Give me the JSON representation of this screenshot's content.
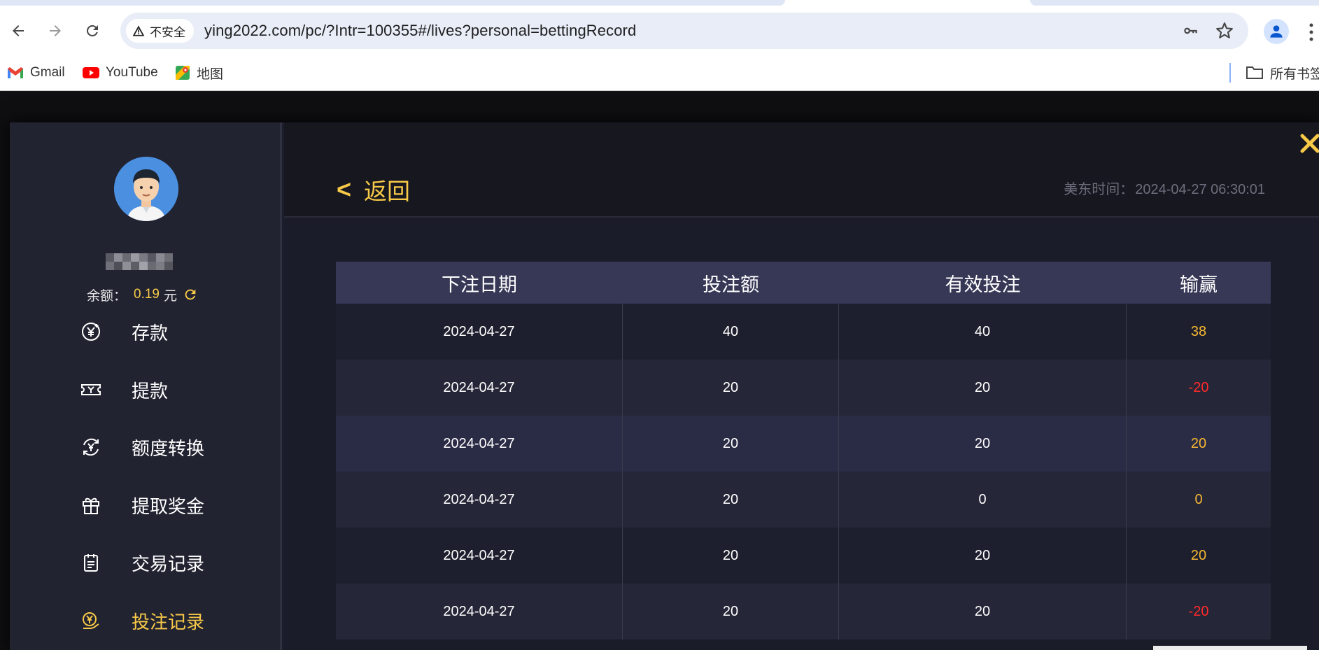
{
  "browser": {
    "security_label": "不安全",
    "url": "ying2022.com/pc/?Intr=100355#/lives?personal=bettingRecord",
    "bookmarks": [
      {
        "label": "Gmail",
        "icon": "gmail-icon"
      },
      {
        "label": "YouTube",
        "icon": "youtube-icon"
      },
      {
        "label": "地图",
        "icon": "maps-icon"
      }
    ],
    "all_bookmarks_label": "所有书签"
  },
  "sidebar": {
    "balance_label": "余额：",
    "balance_value": "0.19",
    "balance_unit": "元",
    "menu": [
      {
        "label": "存款",
        "icon": "deposit-icon",
        "active": false
      },
      {
        "label": "提款",
        "icon": "withdraw-icon",
        "active": false
      },
      {
        "label": "额度转换",
        "icon": "transfer-icon",
        "active": false
      },
      {
        "label": "提取奖金",
        "icon": "gift-icon",
        "active": false
      },
      {
        "label": "交易记录",
        "icon": "clipboard-icon",
        "active": false
      },
      {
        "label": "投注记录",
        "icon": "bet-record-icon",
        "active": true
      }
    ]
  },
  "content": {
    "back_label": "返回",
    "east_time_label": "美东时间：",
    "east_time_value": "2024-04-27 06:30:01"
  },
  "table": {
    "headers": [
      "下注日期",
      "投注额",
      "有效投注",
      "输赢"
    ],
    "rows": [
      {
        "date": "2024-04-27",
        "amount": "40",
        "valid": "40",
        "result": "38"
      },
      {
        "date": "2024-04-27",
        "amount": "20",
        "valid": "20",
        "result": "-20"
      },
      {
        "date": "2024-04-27",
        "amount": "20",
        "valid": "20",
        "result": "20"
      },
      {
        "date": "2024-04-27",
        "amount": "20",
        "valid": "0",
        "result": "0"
      },
      {
        "date": "2024-04-27",
        "amount": "20",
        "valid": "20",
        "result": "20"
      },
      {
        "date": "2024-04-27",
        "amount": "20",
        "valid": "20",
        "result": "-20"
      }
    ]
  },
  "colors": {
    "accent": "#f7c948",
    "win": "#f7b731",
    "loss": "#ff2a2a",
    "header_bg": "#363856"
  }
}
